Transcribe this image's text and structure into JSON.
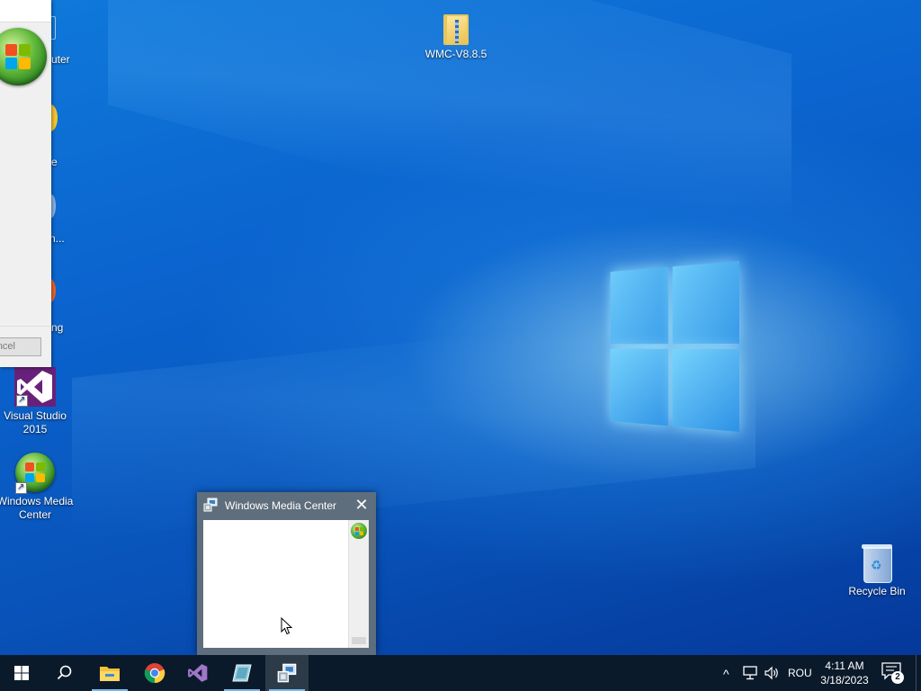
{
  "desktop": {
    "icons": {
      "wmc_folder": "WMC-V8.8.5",
      "visual_studio": "Visual Studio 2015",
      "windows_media_center": "Windows Media Center",
      "recycle_bin": "Recycle Bin"
    },
    "behind_labels": [
      "uter",
      "e",
      "n...",
      "ng"
    ]
  },
  "installer_dialog": {
    "cancel_label": "ncel"
  },
  "wmc_window": {
    "title": "Windows Media Center",
    "close_glyph": "✕"
  },
  "taskbar": {
    "apps": [
      "start-icon",
      "search-icon",
      "file-explorer-icon",
      "chrome-icon",
      "visual-studio-icon",
      "app-icon",
      "wmc-setup-icon"
    ],
    "tray": {
      "chevron": "^",
      "language": "ROU",
      "time": "4:11 AM",
      "date": "3/18/2023",
      "notification_count": "2"
    }
  },
  "colors": {
    "taskbar": "#0b1a2b",
    "desktop_blue": "#0b64cf",
    "window_frame": "#5f6e7c"
  }
}
